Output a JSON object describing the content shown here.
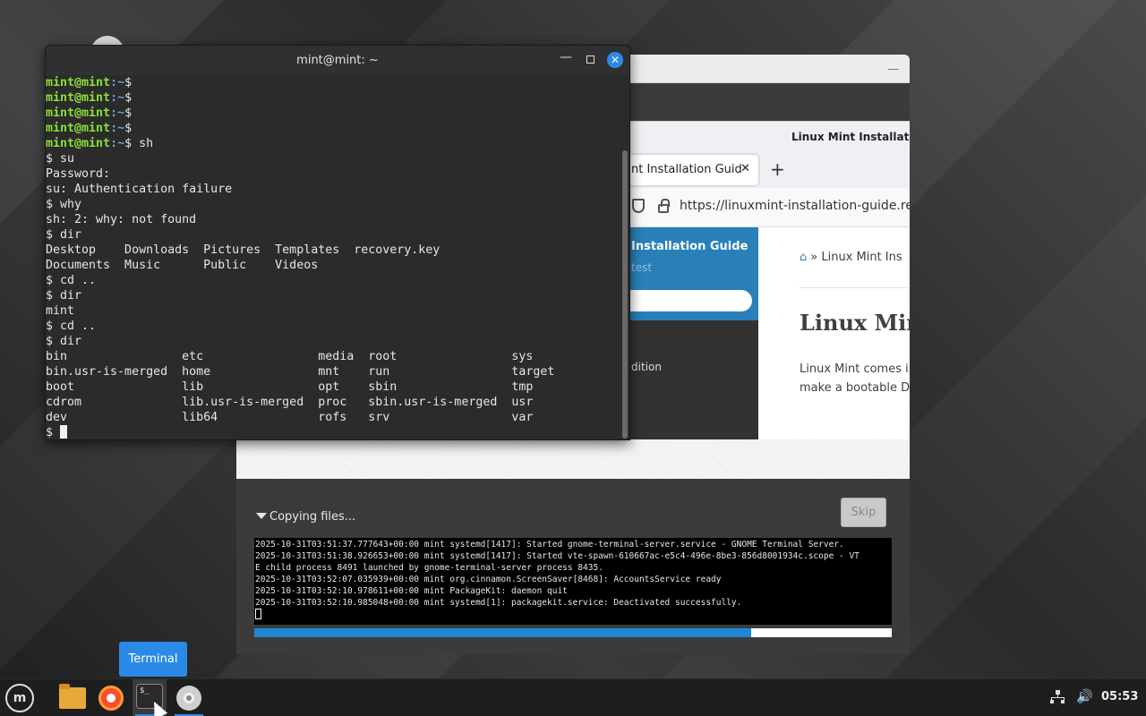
{
  "installer": {
    "status_label": "Copying files...",
    "skip_label": "Skip",
    "progress": 0.78,
    "log_lines": [
      "2025-10-31T03:51:37.777643+00:00 mint systemd[1417]: Started gnome-terminal-server.service - GNOME Terminal Server.",
      "2025-10-31T03:51:38.926653+00:00 mint systemd[1417]: Started vte-spawn-610667ac-e5c4-496e-8be3-856d8001934c.scope - VT",
      "E child process 8491 launched by gnome-terminal-server process 8435.",
      "2025-10-31T03:52:07.035939+00:00 mint org.cinnamon.ScreenSaver[8468]: AccountsService ready",
      "2025-10-31T03:52:10.978611+00:00 mint PackageKit: daemon quit",
      "2025-10-31T03:52:10.985048+00:00 mint systemd[1]: packagekit.service: Deactivated successfully."
    ],
    "browser": {
      "window_title": "Linux Mint Installatio",
      "tab_title": "nt Installation Guid",
      "tab_close": "✕",
      "new_tab": "+",
      "url": "https://linuxmint-installation-guide.readt",
      "sidebar_title": "Installation Guide",
      "sidebar_subtitle": "test",
      "sidebar_item": "dition",
      "breadcrumb": "» Linux Mint Ins",
      "heading": "Linux Min",
      "paragraph_1": "Linux Mint comes in",
      "paragraph_2": "make a bootable DV"
    }
  },
  "terminal": {
    "title": "mint@mint: ~",
    "prompt_user": "mint@mint",
    "prompt_path": ":~",
    "lines": [
      {
        "user": "mint@mint",
        "path": ":~",
        "text": "$ "
      },
      {
        "user": "mint@mint",
        "path": ":~",
        "text": "$ "
      },
      {
        "user": "mint@mint",
        "path": ":~",
        "text": "$ "
      },
      {
        "user": "mint@mint",
        "path": ":~",
        "text": "$ "
      },
      {
        "user": "mint@mint",
        "path": ":~",
        "text": "$ sh"
      },
      {
        "text": "$ su"
      },
      {
        "text": "Password:"
      },
      {
        "text": "su: Authentication failure"
      },
      {
        "text": "$ why"
      },
      {
        "text": "sh: 2: why: not found"
      },
      {
        "text": "$ dir"
      },
      {
        "text": "Desktop    Downloads  Pictures  Templates  recovery.key"
      },
      {
        "text": "Documents  Music      Public    Videos"
      },
      {
        "text": "$ cd .."
      },
      {
        "text": "$ dir"
      },
      {
        "text": "mint"
      },
      {
        "text": "$ cd .."
      },
      {
        "text": "$ dir"
      },
      {
        "text": "bin                etc                media  root                sys"
      },
      {
        "text": "bin.usr-is-merged  home               mnt    run                 target"
      },
      {
        "text": "boot               lib                opt    sbin                tmp"
      },
      {
        "text": "cdrom              lib.usr-is-merged  proc   sbin.usr-is-merged  usr"
      },
      {
        "text": "dev                lib64              rofs   srv                 var"
      }
    ],
    "final_prompt": "$ "
  },
  "tooltip": "Terminal",
  "panel": {
    "menu_icon": "m",
    "clock": "05:53"
  }
}
